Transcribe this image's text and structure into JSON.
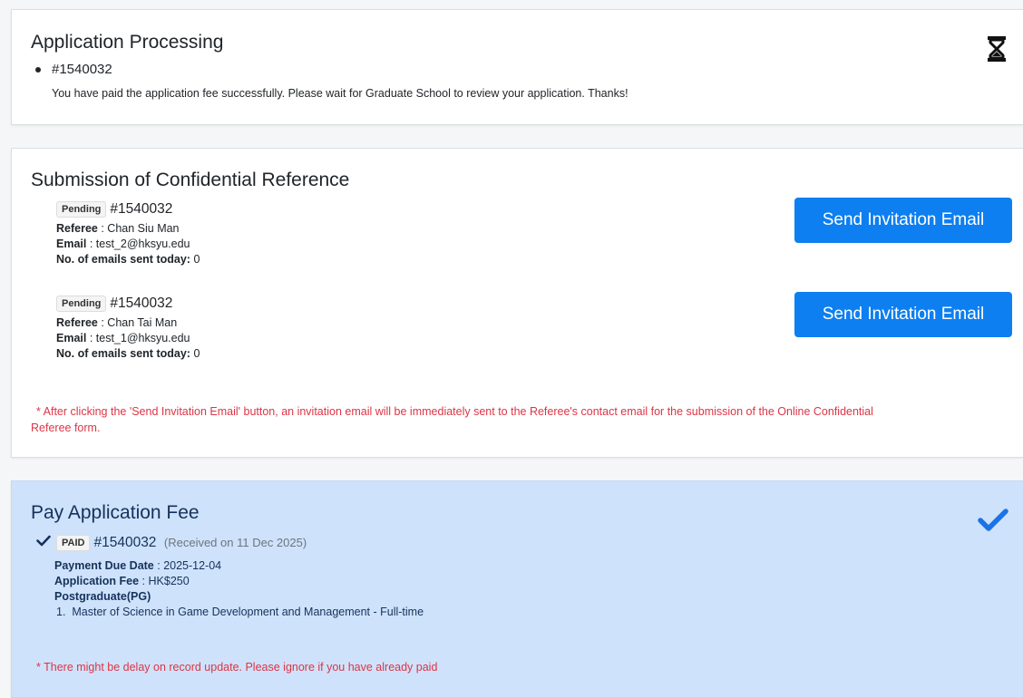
{
  "processing": {
    "title": "Application Processing",
    "app_id": "#1540032",
    "message": "You have paid the application fee successfully. Please wait for Graduate School to review your application. Thanks!",
    "icon": "hourglass-icon"
  },
  "reference": {
    "title": "Submission of Confidential Reference",
    "referee_label": "Referee",
    "email_label": "Email",
    "emails_sent_label": "No. of emails sent today:",
    "items": [
      {
        "status": "Pending",
        "app_id": "#1540032",
        "referee": "Chan Siu Man",
        "email": "test_2@hksyu.edu",
        "emails_sent": "0",
        "button": "Send Invitation Email"
      },
      {
        "status": "Pending",
        "app_id": "#1540032",
        "referee": "Chan Tai Man",
        "email": "test_1@hksyu.edu",
        "emails_sent": "0",
        "button": "Send Invitation Email"
      }
    ],
    "note_line1": "* After clicking the 'Send Invitation Email' button, an invitation email will be immediately sent to the Referee's contact email for the submission of the Online Confidential",
    "note_line2": "Referee form."
  },
  "fee": {
    "title": "Pay Application Fee",
    "badge": "PAID",
    "app_id": "#1540032",
    "received": "(Received on 11 Dec 2025)",
    "due_label": "Payment Due Date",
    "due_value": "2025-12-04",
    "fee_label": "Application Fee",
    "fee_value": "HK$250",
    "category": "Postgraduate(PG)",
    "programmes": [
      "Master of Science in Game Development and Management - Full-time"
    ],
    "note": "* There might be delay on record update. Please ignore if you have already paid"
  },
  "colors": {
    "primary": "#0d7ff0",
    "paid_bg": "#cfe2fb",
    "warning": "#dc3545",
    "check": "#1a73e8"
  }
}
